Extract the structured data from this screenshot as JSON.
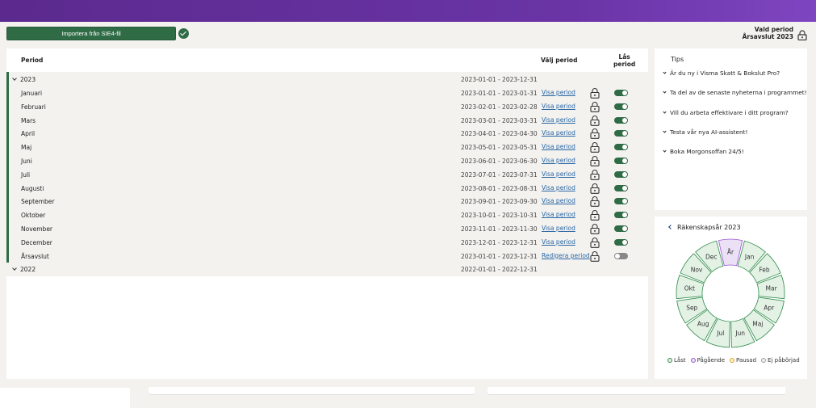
{
  "colors": {
    "accent_green": "#2f6b45",
    "brand_purple": "#6a34a6",
    "link_blue": "#2a67a6"
  },
  "toolbar": {
    "import_label": "Importera från SIE4-fil",
    "vald_line1": "Vald period",
    "vald_line2": "Årsavslut 2023"
  },
  "table": {
    "headers": {
      "period": "Period",
      "valj": "Välj period",
      "las_line1": "Lås",
      "las_line2": "period"
    },
    "year_2023": {
      "label": "2023",
      "dates": "2023-01-01 - 2023-12-31"
    },
    "rows": [
      {
        "name": "Januari",
        "dates": "2023-01-01 - 2023-01-31",
        "link": "Visa period",
        "locked": true
      },
      {
        "name": "Februari",
        "dates": "2023-02-01 - 2023-02-28",
        "link": "Visa period",
        "locked": true
      },
      {
        "name": "Mars",
        "dates": "2023-03-01 - 2023-03-31",
        "link": "Visa period",
        "locked": true
      },
      {
        "name": "April",
        "dates": "2023-04-01 - 2023-04-30",
        "link": "Visa period",
        "locked": true
      },
      {
        "name": "Maj",
        "dates": "2023-05-01 - 2023-05-31",
        "link": "Visa period",
        "locked": true
      },
      {
        "name": "Juni",
        "dates": "2023-06-01 - 2023-06-30",
        "link": "Visa period",
        "locked": true
      },
      {
        "name": "Juli",
        "dates": "2023-07-01 - 2023-07-31",
        "link": "Visa period",
        "locked": true
      },
      {
        "name": "Augusti",
        "dates": "2023-08-01 - 2023-08-31",
        "link": "Visa period",
        "locked": true
      },
      {
        "name": "September",
        "dates": "2023-09-01 - 2023-09-30",
        "link": "Visa period",
        "locked": true
      },
      {
        "name": "Oktober",
        "dates": "2023-10-01 - 2023-10-31",
        "link": "Visa period",
        "locked": true
      },
      {
        "name": "November",
        "dates": "2023-11-01 - 2023-11-30",
        "link": "Visa period",
        "locked": true
      },
      {
        "name": "December",
        "dates": "2023-12-01 - 2023-12-31",
        "link": "Visa period",
        "locked": true
      },
      {
        "name": "Årsavslut",
        "dates": "2023-01-01 - 2023-12-31",
        "link": "Redigera period",
        "locked": false
      }
    ],
    "year_2022": {
      "label": "2022",
      "dates": "2022-01-01 - 2022-12-31"
    }
  },
  "tips": {
    "title": "Tips",
    "items": [
      "Är du ny i Visma Skatt & Bokslut Pro?",
      "Ta del av de senaste nyheterna i programmet!",
      "Vill du arbeta effektivare i ditt program?",
      "Testa vår nya AI-assistent!",
      "Boka Morgonsoffan 24/5!"
    ]
  },
  "calendar": {
    "title": "Räkenskapsår 2023",
    "months": [
      "År",
      "Jan",
      "Feb",
      "Mar",
      "Apr",
      "Maj",
      "Jun",
      "Jul",
      "Aug",
      "Sep",
      "Okt",
      "Nov",
      "Dec"
    ],
    "statuses": [
      "pagaende",
      "last",
      "last",
      "last",
      "last",
      "last",
      "last",
      "last",
      "last",
      "last",
      "last",
      "last",
      "last"
    ],
    "legend": {
      "last": "Låst",
      "pagaende": "Pågående",
      "pausad": "Pausad",
      "ej": "Ej påbörjad"
    }
  }
}
